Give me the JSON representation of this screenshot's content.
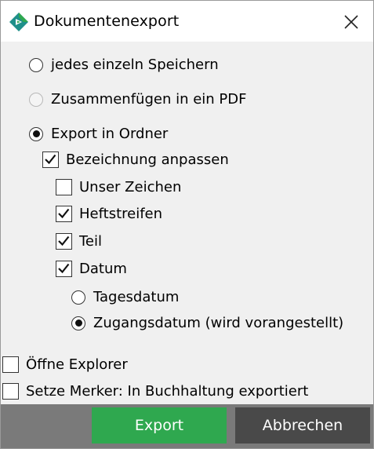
{
  "window": {
    "title": "Dokumentenexport"
  },
  "options": {
    "save_each": "jedes einzeln Speichern",
    "merge_pdf": "Zusammenfügen in ein PDF",
    "export_folder": "Export in Ordner",
    "adjust_name": "Bezeichnung anpassen",
    "our_sign": "Unser Zeichen",
    "binder": "Heftstreifen",
    "part": "Teil",
    "date": "Datum",
    "today_date": "Tagesdatum",
    "receipt_date": "Zugangsdatum (wird vorangestellt)",
    "open_explorer": "Öffne Explorer",
    "set_marker": "Setze Merker: In Buchhaltung exportiert"
  },
  "state": {
    "selected_mode": "export_folder",
    "merge_pdf_disabled": true,
    "adjust_name_checked": true,
    "our_sign_checked": false,
    "binder_checked": true,
    "part_checked": true,
    "date_checked": true,
    "date_mode": "receipt_date",
    "open_explorer_checked": false,
    "set_marker_checked": false
  },
  "buttons": {
    "export": "Export",
    "cancel": "Abbrechen"
  },
  "icons": {
    "app": "app-logo-icon",
    "close": "close-icon"
  },
  "colors": {
    "export_button": "#2fa84f",
    "cancel_button": "#494949",
    "footer": "#7a7a7a",
    "logo_green": "#2fa84f",
    "logo_teal": "#1f8f8a"
  }
}
